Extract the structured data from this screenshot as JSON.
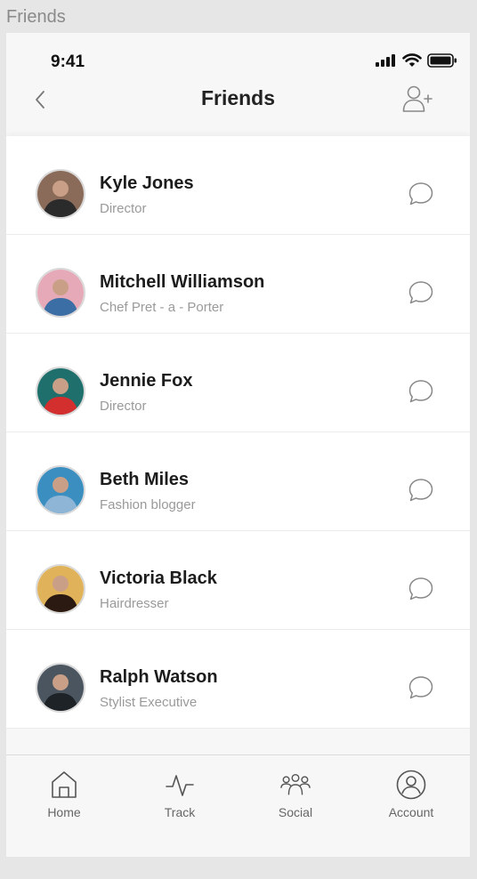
{
  "frame_title": "Friends",
  "status_bar": {
    "time": "9:41"
  },
  "header": {
    "title": "Friends"
  },
  "friends": [
    {
      "name": "Kyle Jones",
      "role": "Director",
      "avatar_colors": [
        "#8a6b5a",
        "#2b2b2b"
      ]
    },
    {
      "name": "Mitchell Williamson",
      "role": "Chef Pret - a - Porter",
      "avatar_colors": [
        "#e6a9b8",
        "#3a6ea5"
      ]
    },
    {
      "name": "Jennie Fox",
      "role": "Director",
      "avatar_colors": [
        "#1f6f6c",
        "#d32f2f"
      ]
    },
    {
      "name": "Beth Miles",
      "role": "Fashion blogger",
      "avatar_colors": [
        "#3a8fc0",
        "#8fb5d6"
      ]
    },
    {
      "name": "Victoria Black",
      "role": "Hairdresser",
      "avatar_colors": [
        "#e0b25a",
        "#2b1a12"
      ]
    },
    {
      "name": "Ralph Watson",
      "role": "Stylist Executive",
      "avatar_colors": [
        "#4a5560",
        "#1e2328"
      ]
    }
  ],
  "tabs": [
    {
      "label": "Home",
      "icon": "home-icon"
    },
    {
      "label": "Track",
      "icon": "activity-icon"
    },
    {
      "label": "Social",
      "icon": "group-icon"
    },
    {
      "label": "Account",
      "icon": "account-icon"
    }
  ]
}
